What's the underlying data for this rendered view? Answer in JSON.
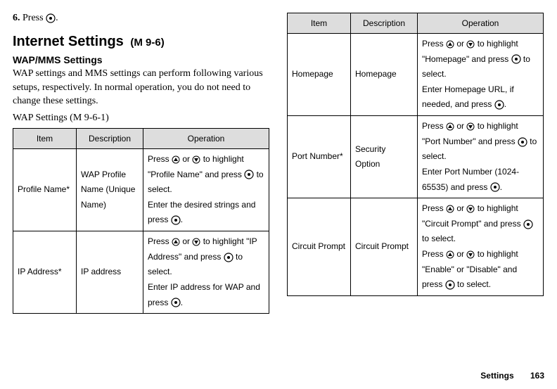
{
  "step": {
    "number": "6.",
    "text_before": "Press ",
    "text_after": "."
  },
  "heading": {
    "title": "Internet Settings",
    "code": "(M 9-6)"
  },
  "subheading": "WAP/MMS Settings",
  "intro": "WAP settings and MMS settings can perform following various setups, respectively. In normal operation, you do not need to change these settings.",
  "table_caption": "WAP Settings (M 9-6-1)",
  "table_headers": {
    "item": "Item",
    "description": "Description",
    "operation": "Operation"
  },
  "rows": [
    {
      "item": "Profile Name*",
      "description": "WAP Profile Name (Unique Name)",
      "op_parts": {
        "p1a": "Press ",
        "p1b": " or ",
        "p1c": " to highlight \"Profile Name\" and press ",
        "p1d": " to select.",
        "p2a": "Enter the desired strings and press ",
        "p2b": "."
      }
    },
    {
      "item": "IP Address*",
      "description": "IP address",
      "op_parts": {
        "p1a": "Press ",
        "p1b": " or ",
        "p1c": " to highlight \"IP Address\" and press ",
        "p1d": " to select.",
        "p2a": "Enter IP address for WAP and press ",
        "p2b": "."
      }
    },
    {
      "item": "Homepage",
      "description": "Homepage",
      "op_parts": {
        "p1a": "Press ",
        "p1b": " or ",
        "p1c": " to highlight \"Homepage\" and press ",
        "p1d": " to select.",
        "p2a": "Enter Homepage URL, if needed, and press ",
        "p2b": "."
      }
    },
    {
      "item": "Port Number*",
      "description": "Security Option",
      "op_parts": {
        "p1a": "Press ",
        "p1b": " or ",
        "p1c": " to highlight \"Port Number\" and press ",
        "p1d": " to select.",
        "p2a": "Enter Port Number (1024-65535) and press ",
        "p2b": "."
      }
    },
    {
      "item": "Circuit Prompt",
      "description": "Circuit Prompt",
      "op_parts": {
        "p1a": "Press ",
        "p1b": " or ",
        "p1c": " to highlight \"Circuit Prompt\" and press ",
        "p1d": " to select.",
        "p2a": "Press ",
        "p2b": " or ",
        "p2c": " to highlight \"Enable\" or \"Disable\" and press ",
        "p2d": " to select."
      }
    }
  ],
  "footer": {
    "section": "Settings",
    "page": "163"
  }
}
